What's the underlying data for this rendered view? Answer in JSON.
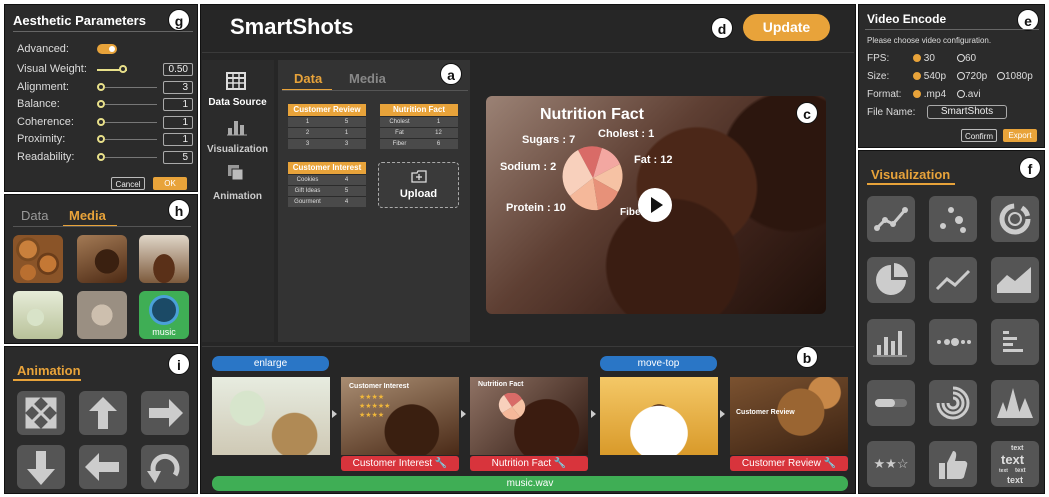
{
  "aesthetic": {
    "title": "Aesthetic Parameters",
    "badge": "g",
    "rows": [
      {
        "label": "Advanced:",
        "value": ""
      },
      {
        "label": "Visual Weight:",
        "value": "0.50"
      },
      {
        "label": "Alignment:",
        "value": "3"
      },
      {
        "label": "Balance:",
        "value": "1"
      },
      {
        "label": "Coherence:",
        "value": "1"
      },
      {
        "label": "Proximity:",
        "value": "1"
      },
      {
        "label": "Readability:",
        "value": "5"
      }
    ],
    "cancel": "Cancel",
    "ok": "OK"
  },
  "media_panel": {
    "badge": "h",
    "tab_data": "Data",
    "tab_media": "Media",
    "music_label": "music"
  },
  "animation": {
    "title": "Animation",
    "badge": "i"
  },
  "app": {
    "title": "SmartShots",
    "update": "Update",
    "badge_update": "d"
  },
  "sidebar": {
    "data_source": "Data Source",
    "visualization": "Visualization",
    "animation": "Animation"
  },
  "data_panel": {
    "badge": "a",
    "tab_data": "Data",
    "tab_media": "Media",
    "upload": "Upload",
    "tables": {
      "review": {
        "title": "Customer Review",
        "rows": [
          [
            "1",
            "5"
          ],
          [
            "2",
            "1"
          ],
          [
            "3",
            "3"
          ]
        ]
      },
      "nutrition": {
        "title": "Nutrition Fact",
        "rows": [
          [
            "Cholest",
            "1"
          ],
          [
            "Fat",
            "12"
          ],
          [
            "Fiber",
            "6"
          ]
        ]
      },
      "interest": {
        "title": "Customer Interest",
        "rows": [
          [
            "Cookies",
            "4"
          ],
          [
            "Gift Ideas",
            "5"
          ],
          [
            "Gourment",
            "4"
          ]
        ]
      }
    }
  },
  "preview": {
    "badge": "c",
    "title": "Nutrition Fact",
    "labels": {
      "sugars": "Sugars : 7",
      "cholest": "Cholest : 1",
      "sodium": "Sodium : 2",
      "fat": "Fat : 12",
      "protein": "Protein : 10",
      "fiber": "Fiber : 6"
    }
  },
  "timeline": {
    "badge": "b",
    "anim_labels": [
      "enlarge",
      "move-top"
    ],
    "frames": [
      {
        "label": ""
      },
      {
        "label": "Customer Interest",
        "overlay": "Customer Interest"
      },
      {
        "label": "Nutrition Fact",
        "overlay": "Nutrition Fact"
      },
      {
        "label": ""
      },
      {
        "label": "Customer Review",
        "overlay": "Customer Review"
      }
    ],
    "audio": "music.wav"
  },
  "video_encode": {
    "title": "Video Encode",
    "badge": "e",
    "prompt": "Please choose video configuration.",
    "fps_label": "FPS:",
    "fps_options": [
      "30",
      "60"
    ],
    "size_label": "Size:",
    "size_options": [
      "540p",
      "720p",
      "1080p"
    ],
    "format_label": "Format:",
    "format_options": [
      ".mp4",
      ".avi"
    ],
    "filename_label": "File Name:",
    "filename_value": "SmartShots",
    "confirm": "Confirm",
    "export": "Export"
  },
  "visualization": {
    "title": "Visualization",
    "badge": "f",
    "icons": [
      "line-chart-icon",
      "scatter-icon",
      "donut-icon",
      "pie-icon",
      "trend-line-icon",
      "area-chart-icon",
      "bar-chart-icon",
      "dot-strip-icon",
      "horizontal-bar-icon",
      "progress-bar-icon",
      "radial-bar-icon",
      "peaks-icon",
      "star-rating-icon",
      "thumbs-up-icon",
      "word-cloud-icon"
    ],
    "wordcloud": {
      "w1": "text",
      "w2": "text",
      "w3": "text",
      "w4": "text",
      "w5": "text"
    }
  },
  "colors": {
    "accent": "#e8a33a",
    "blue": "#2a76c6",
    "red": "#d8343c",
    "green": "#3fae55",
    "panel": "#2b2b2b"
  }
}
